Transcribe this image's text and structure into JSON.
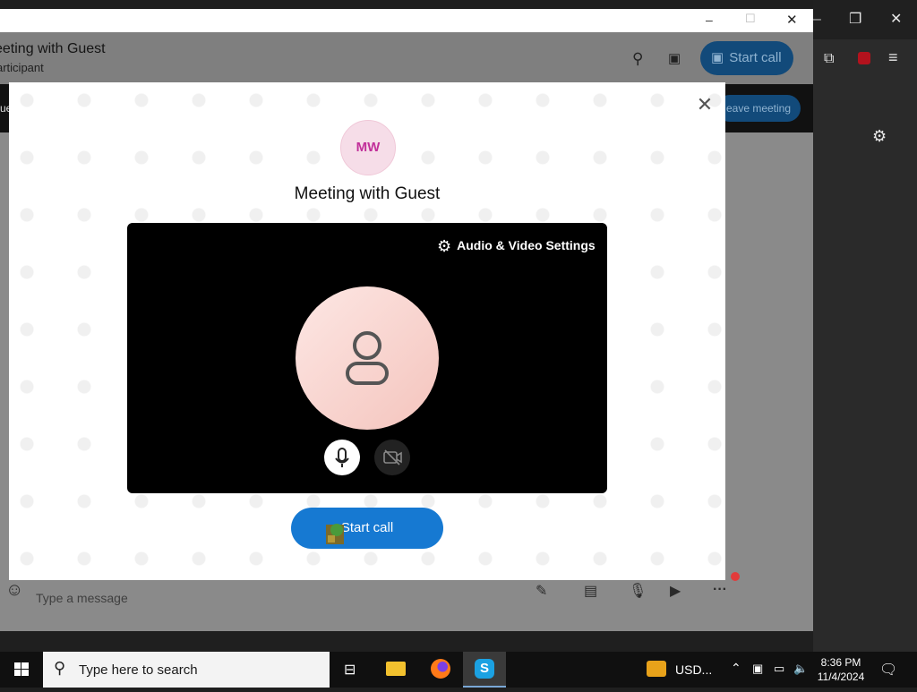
{
  "skype": {
    "header_title": "eeting with Guest",
    "header_subtitle": "articipant",
    "start_call_top_label": "Start call",
    "leave_meeting_label": "eave meeting",
    "banner_left_text": "ue",
    "message_placeholder": "Type a message"
  },
  "modal": {
    "avatar_initials": "MW",
    "title": "Meeting with Guest",
    "av_settings_label": "Audio & Video Settings",
    "start_call_label": "Start call"
  },
  "taskbar": {
    "search_placeholder": "Type here to search",
    "currency_label": "USD...",
    "time": "8:36 PM",
    "date": "11/4/2024"
  },
  "colors": {
    "skype_blue": "#1679d2",
    "avatar_text": "#c2309a",
    "taskbar_bg": "#101010"
  }
}
